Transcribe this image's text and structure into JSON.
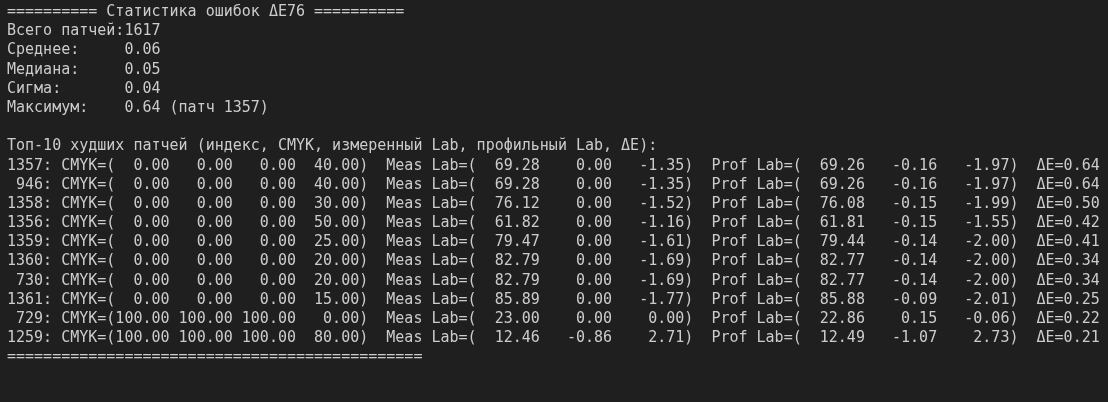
{
  "header": "========== Статистика ошибок ΔE76 ==========",
  "stats": [
    {
      "label": "Всего патчей:",
      "value": "1617"
    },
    {
      "label": "Среднее:",
      "value": "0.06"
    },
    {
      "label": "Медиана:",
      "value": "0.05"
    },
    {
      "label": "Сигма:",
      "value": "0.04"
    },
    {
      "label": "Максимум:",
      "value": "0.64 (патч 1357)"
    }
  ],
  "table_title": "Топ-10 худших патчей (индекс, CMYK, измеренный Lab, профильный Lab, ΔE):",
  "rows": [
    "1357: CMYK=(  0.00   0.00   0.00  40.00)  Meas Lab=(  69.28    0.00   -1.35)  Prof Lab=(  69.26   -0.16   -1.97)  ΔE=0.64",
    " 946: CMYK=(  0.00   0.00   0.00  40.00)  Meas Lab=(  69.28    0.00   -1.35)  Prof Lab=(  69.26   -0.16   -1.97)  ΔE=0.64",
    "1358: CMYK=(  0.00   0.00   0.00  30.00)  Meas Lab=(  76.12    0.00   -1.52)  Prof Lab=(  76.08   -0.15   -1.99)  ΔE=0.50",
    "1356: CMYK=(  0.00   0.00   0.00  50.00)  Meas Lab=(  61.82    0.00   -1.16)  Prof Lab=(  61.81   -0.15   -1.55)  ΔE=0.42",
    "1359: CMYK=(  0.00   0.00   0.00  25.00)  Meas Lab=(  79.47    0.00   -1.61)  Prof Lab=(  79.44   -0.14   -2.00)  ΔE=0.41",
    "1360: CMYK=(  0.00   0.00   0.00  20.00)  Meas Lab=(  82.79    0.00   -1.69)  Prof Lab=(  82.77   -0.14   -2.00)  ΔE=0.34",
    " 730: CMYK=(  0.00   0.00   0.00  20.00)  Meas Lab=(  82.79    0.00   -1.69)  Prof Lab=(  82.77   -0.14   -2.00)  ΔE=0.34",
    "1361: CMYK=(  0.00   0.00   0.00  15.00)  Meas Lab=(  85.89    0.00   -1.77)  Prof Lab=(  85.88   -0.09   -2.01)  ΔE=0.25",
    " 729: CMYK=(100.00 100.00 100.00   0.00)  Meas Lab=(  23.00    0.00    0.00)  Prof Lab=(  22.86    0.15   -0.06)  ΔE=0.22",
    "1259: CMYK=(100.00 100.00 100.00  80.00)  Meas Lab=(  12.46   -0.86    2.71)  Prof Lab=(  12.49   -1.07    2.73)  ΔE=0.21"
  ],
  "footer": "=============================================="
}
